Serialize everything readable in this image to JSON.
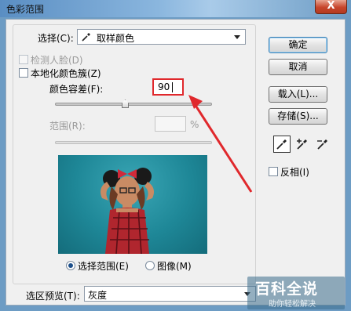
{
  "window": {
    "title": "色彩范围",
    "close_label": "X"
  },
  "select": {
    "label": "选择(C):",
    "value": "取样颜色"
  },
  "options": {
    "detect_faces": "检测人脸(D)",
    "localized_clusters": "本地化颜色簇(Z)"
  },
  "fuzziness": {
    "label": "颜色容差(F):",
    "value": "90"
  },
  "range": {
    "label": "范围(R):",
    "value": "",
    "unit": "%"
  },
  "buttons": {
    "ok": "确定",
    "cancel": "取消",
    "load": "载入(L)...",
    "save": "存储(S)..."
  },
  "eyedroppers": [
    "eyedropper-icon",
    "eyedropper-plus-icon",
    "eyedropper-minus-icon"
  ],
  "invert": {
    "label": "反相(I)"
  },
  "view": {
    "selection": "选择范围(E)",
    "image": "图像(M)"
  },
  "selection_preview": {
    "label": "选区预览(T):",
    "value": "灰度"
  },
  "watermark": {
    "main": "百科全说",
    "sub": "助你轻松解决"
  },
  "colors": {
    "annotation_red": "#e0282c",
    "preview_background": "#1e8797",
    "default_button_border": "#3c7fb1"
  }
}
